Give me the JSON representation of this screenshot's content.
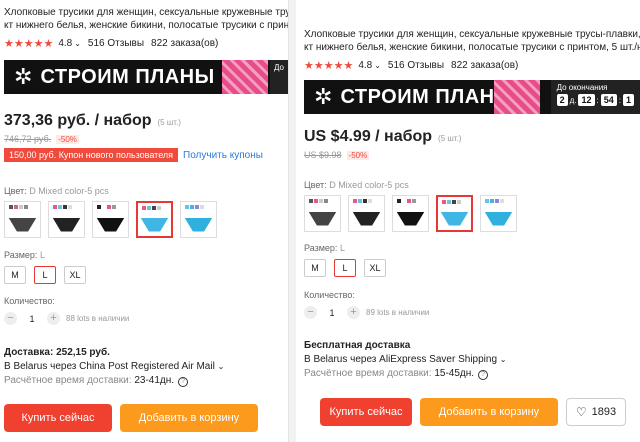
{
  "left": {
    "title_line1": "Хлопковые трусики для женщин, сексуальные кружевные тру",
    "title_line2": "кт нижнего белья, женские бикини, полосатые трусики с принт",
    "rating": "4.8",
    "reviews": "516 Отзывы",
    "orders": "822 заказа(ов)",
    "banner_text": "СТРОИМ ПЛАНЫ",
    "banner_countdown_label": "До",
    "price": "373,36 руб. / набор",
    "sets": "(5 шт.)",
    "old_price": "746,72 руб.",
    "discount": "-50%",
    "coupon": "150,00 руб. Купон нового пользователя",
    "coupon_link": "Получить купоны",
    "color_label": "Цвет:",
    "color_value": "D Mixed color-5 pcs",
    "size_label": "Размер:",
    "size_value": "L",
    "sizes": [
      "M",
      "L",
      "XL"
    ],
    "qty_label": "Количество:",
    "qty": "1",
    "qty_note": "88 lots в наличии",
    "ship_title": "Доставка: 252,15 руб.",
    "ship_line": "В Belarus через China Post Registered Air Mail",
    "ship_time_label": "Расчётное время доставки:",
    "ship_time": "23-41дн.",
    "buy_label": "Купить сейчас",
    "cart_label": "Добавить в корзину"
  },
  "right": {
    "title_line1": "Хлопковые трусики для женщин, сексуальные кружевные трусы-плавки, ко",
    "title_line2": "кт нижнего белья, женские бикини, полосатые трусики с принтом, 5 шт./на",
    "rating": "4.8",
    "reviews": "516 Отзывы",
    "orders": "822 заказа(ов)",
    "banner_text": "СТРОИМ ПЛАНЫ",
    "countdown_label": "До окончания",
    "countdown_days": "2",
    "countdown_days_unit": "д.",
    "countdown_hours": "12",
    "countdown_minutes": "54",
    "countdown_seconds": "1",
    "price": "US $4.99 / набор",
    "sets": "(5 шт.)",
    "old_price": "US $9.98",
    "discount": "-50%",
    "color_label": "Цвет:",
    "color_value": "D Mixed color-5 pcs",
    "size_label": "Размер:",
    "size_value": "L",
    "sizes": [
      "M",
      "L",
      "XL"
    ],
    "qty_label": "Количество:",
    "qty": "1",
    "qty_note": "89 lots в наличии",
    "ship_title": "Бесплатная доставка",
    "ship_line": "В Belarus через AliExpress Saver Shipping",
    "ship_time_label": "Расчётное время доставки:",
    "ship_time": "15-45дн.",
    "buy_label": "Купить сейчас",
    "cart_label": "Добавить в корзину",
    "wish_count": "1893"
  },
  "swatches": [
    {
      "colors": [
        "#555",
        "#e35a8a",
        "#c9c9c9",
        "#888"
      ],
      "brief": "#444"
    },
    {
      "colors": [
        "#e35a8a",
        "#6ac4dd",
        "#333",
        "#ddd"
      ],
      "brief": "#222"
    },
    {
      "colors": [
        "#222",
        "#fff",
        "#e35a8a",
        "#999"
      ],
      "brief": "#111"
    },
    {
      "colors": [
        "#e35a8a",
        "#6ac4dd",
        "#444",
        "#ccc"
      ],
      "brief": "#3fb6e3"
    },
    {
      "colors": [
        "#6ac4dd",
        "#3fb6e3",
        "#88d",
        "#ddd"
      ],
      "brief": "#2fb0de"
    }
  ],
  "selected_swatch": 3,
  "icons": {
    "logo": "snowflake-logo-icon",
    "star": "star-icon",
    "help": "question-circle-icon",
    "heart": "heart-icon",
    "chevron": "chevron-down-icon"
  },
  "colors": {
    "accent_red": "#f0402f",
    "cart_orange": "#fb9a1c",
    "star_red": "#f04a3c",
    "link_blue": "#2a7bd8"
  }
}
